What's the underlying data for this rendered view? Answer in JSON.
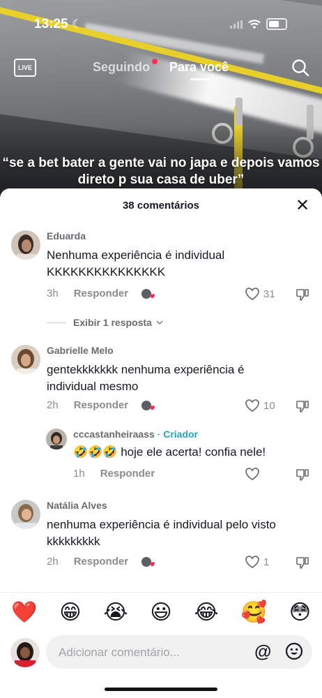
{
  "status_bar": {
    "time": "13:25"
  },
  "top_nav": {
    "live_label": "LIVE",
    "following": "Seguindo",
    "for_you": "Para você"
  },
  "video": {
    "caption": "“se a bet bater a gente vai no japa e depois vamos direto p sua casa de uber”"
  },
  "sheet": {
    "title": "38 comentários",
    "comments": [
      {
        "author": "Eduarda",
        "text": "Nenhuma experiência é individual KKKKKKKKKKKKKKK",
        "time": "3h",
        "reply": "Responder",
        "likes": "31",
        "view_replies": "Exibir 1 resposta"
      },
      {
        "author": "Gabrielle Melo",
        "text": "gentekkkkkkk nenhuma experiência é individual mesmo",
        "time": "2h",
        "reply": "Responder",
        "likes": "10",
        "replies": [
          {
            "author": "cccastanheiraass",
            "badge": "· Criador",
            "text": "🤣🤣🤣 hoje ele acerta! confia nele!",
            "time": "1h",
            "reply": "Responder"
          }
        ]
      },
      {
        "author": "Natália Alves",
        "text": "nenhuma experiência é individual pelo visto kkkkkkkkk",
        "time": "2h",
        "reply": "Responder",
        "likes": "1"
      }
    ]
  },
  "emoji_bar": [
    "❤️",
    "😁",
    "😭",
    "😃",
    "😂",
    "🥰",
    "😳"
  ],
  "input": {
    "placeholder": "Adicionar comentário...",
    "mention_symbol": "@"
  },
  "colors": {
    "accent_red": "#fe2c55",
    "creator_teal": "#20a4bd"
  },
  "icons": [
    "moon-icon",
    "signal-icon",
    "wifi-icon",
    "battery-icon",
    "search-icon",
    "close-icon",
    "heart-icon",
    "dislike-icon",
    "chevron-down-icon",
    "smiley-icon"
  ]
}
